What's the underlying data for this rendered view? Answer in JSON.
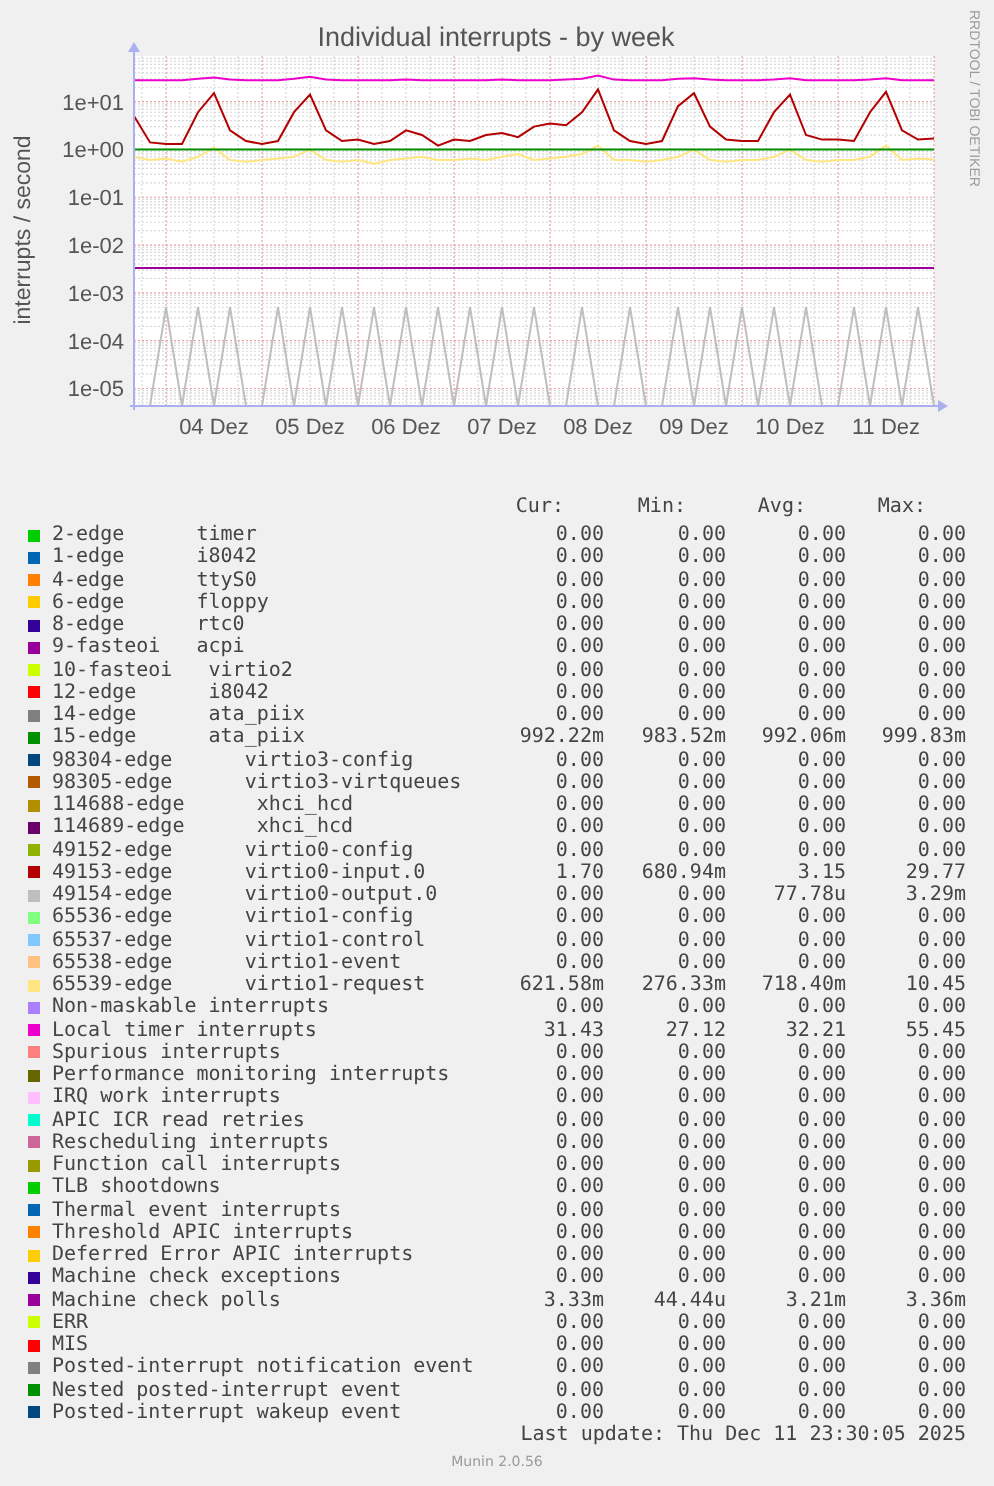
{
  "chart": {
    "title": "Individual interrupts - by week",
    "ylabel": "interrupts / second",
    "credit": "RRDTOOL / TOBI OETIKER",
    "y_labels": [
      "1e+01",
      "1e+00",
      "1e-01",
      "1e-02",
      "1e-03",
      "1e-04",
      "1e-05"
    ],
    "x_labels": [
      "04 Dez",
      "05 Dez",
      "06 Dez",
      "07 Dez",
      "08 Dez",
      "09 Dez",
      "10 Dez",
      "11 Dez"
    ]
  },
  "legend": {
    "columns": [
      "Cur:",
      "Min:",
      "Avg:",
      "Max:"
    ],
    "items": [
      {
        "label": "2-edge      timer",
        "color": "#00cc00",
        "cur": "0.00",
        "min": "0.00",
        "avg": "0.00",
        "max": "0.00"
      },
      {
        "label": "1-edge      i8042",
        "color": "#0066b3",
        "cur": "0.00",
        "min": "0.00",
        "avg": "0.00",
        "max": "0.00"
      },
      {
        "label": "4-edge      ttyS0",
        "color": "#ff8000",
        "cur": "0.00",
        "min": "0.00",
        "avg": "0.00",
        "max": "0.00"
      },
      {
        "label": "6-edge      floppy",
        "color": "#ffcc00",
        "cur": "0.00",
        "min": "0.00",
        "avg": "0.00",
        "max": "0.00"
      },
      {
        "label": "8-edge      rtc0",
        "color": "#330099",
        "cur": "0.00",
        "min": "0.00",
        "avg": "0.00",
        "max": "0.00"
      },
      {
        "label": "9-fasteoi   acpi",
        "color": "#990099",
        "cur": "0.00",
        "min": "0.00",
        "avg": "0.00",
        "max": "0.00"
      },
      {
        "label": "10-fasteoi   virtio2",
        "color": "#ccff00",
        "cur": "0.00",
        "min": "0.00",
        "avg": "0.00",
        "max": "0.00"
      },
      {
        "label": "12-edge      i8042",
        "color": "#ff0000",
        "cur": "0.00",
        "min": "0.00",
        "avg": "0.00",
        "max": "0.00"
      },
      {
        "label": "14-edge      ata_piix",
        "color": "#808080",
        "cur": "0.00",
        "min": "0.00",
        "avg": "0.00",
        "max": "0.00"
      },
      {
        "label": "15-edge      ata_piix",
        "color": "#008f00",
        "cur": "992.22m",
        "min": "983.52m",
        "avg": "992.06m",
        "max": "999.83m"
      },
      {
        "label": "98304-edge      virtio3-config",
        "color": "#00487d",
        "cur": "0.00",
        "min": "0.00",
        "avg": "0.00",
        "max": "0.00"
      },
      {
        "label": "98305-edge      virtio3-virtqueues",
        "color": "#b35a00",
        "cur": "0.00",
        "min": "0.00",
        "avg": "0.00",
        "max": "0.00"
      },
      {
        "label": "114688-edge      xhci_hcd",
        "color": "#b38f00",
        "cur": "0.00",
        "min": "0.00",
        "avg": "0.00",
        "max": "0.00"
      },
      {
        "label": "114689-edge      xhci_hcd",
        "color": "#6b006b",
        "cur": "0.00",
        "min": "0.00",
        "avg": "0.00",
        "max": "0.00"
      },
      {
        "label": "49152-edge      virtio0-config",
        "color": "#8fb300",
        "cur": "0.00",
        "min": "0.00",
        "avg": "0.00",
        "max": "0.00"
      },
      {
        "label": "49153-edge      virtio0-input.0",
        "color": "#b30000",
        "cur": "1.70",
        "min": "680.94m",
        "avg": "3.15",
        "max": "29.77"
      },
      {
        "label": "49154-edge      virtio0-output.0",
        "color": "#bebebe",
        "cur": "0.00",
        "min": "0.00",
        "avg": "77.78u",
        "max": "3.29m"
      },
      {
        "label": "65536-edge      virtio1-config",
        "color": "#80ff80",
        "cur": "0.00",
        "min": "0.00",
        "avg": "0.00",
        "max": "0.00"
      },
      {
        "label": "65537-edge      virtio1-control",
        "color": "#80c9ff",
        "cur": "0.00",
        "min": "0.00",
        "avg": "0.00",
        "max": "0.00"
      },
      {
        "label": "65538-edge      virtio1-event",
        "color": "#ffc080",
        "cur": "0.00",
        "min": "0.00",
        "avg": "0.00",
        "max": "0.00"
      },
      {
        "label": "65539-edge      virtio1-request",
        "color": "#ffe680",
        "cur": "621.58m",
        "min": "276.33m",
        "avg": "718.40m",
        "max": "10.45"
      },
      {
        "label": "Non-maskable interrupts",
        "color": "#aa80ff",
        "cur": "0.00",
        "min": "0.00",
        "avg": "0.00",
        "max": "0.00"
      },
      {
        "label": "Local timer interrupts",
        "color": "#ee00cc",
        "cur": "31.43",
        "min": "27.12",
        "avg": "32.21",
        "max": "55.45"
      },
      {
        "label": "Spurious interrupts",
        "color": "#ff8080",
        "cur": "0.00",
        "min": "0.00",
        "avg": "0.00",
        "max": "0.00"
      },
      {
        "label": "Performance monitoring interrupts",
        "color": "#666600",
        "cur": "0.00",
        "min": "0.00",
        "avg": "0.00",
        "max": "0.00"
      },
      {
        "label": "IRQ work interrupts",
        "color": "#ffbfff",
        "cur": "0.00",
        "min": "0.00",
        "avg": "0.00",
        "max": "0.00"
      },
      {
        "label": "APIC ICR read retries",
        "color": "#00ffcc",
        "cur": "0.00",
        "min": "0.00",
        "avg": "0.00",
        "max": "0.00"
      },
      {
        "label": "Rescheduling interrupts",
        "color": "#cc6699",
        "cur": "0.00",
        "min": "0.00",
        "avg": "0.00",
        "max": "0.00"
      },
      {
        "label": "Function call interrupts",
        "color": "#999900",
        "cur": "0.00",
        "min": "0.00",
        "avg": "0.00",
        "max": "0.00"
      },
      {
        "label": "TLB shootdowns",
        "color": "#00cc00",
        "cur": "0.00",
        "min": "0.00",
        "avg": "0.00",
        "max": "0.00"
      },
      {
        "label": "Thermal event interrupts",
        "color": "#0066b3",
        "cur": "0.00",
        "min": "0.00",
        "avg": "0.00",
        "max": "0.00"
      },
      {
        "label": "Threshold APIC interrupts",
        "color": "#ff8000",
        "cur": "0.00",
        "min": "0.00",
        "avg": "0.00",
        "max": "0.00"
      },
      {
        "label": "Deferred Error APIC interrupts",
        "color": "#ffcc00",
        "cur": "0.00",
        "min": "0.00",
        "avg": "0.00",
        "max": "0.00"
      },
      {
        "label": "Machine check exceptions",
        "color": "#330099",
        "cur": "0.00",
        "min": "0.00",
        "avg": "0.00",
        "max": "0.00"
      },
      {
        "label": "Machine check polls",
        "color": "#990099",
        "cur": "3.33m",
        "min": "44.44u",
        "avg": "3.21m",
        "max": "3.36m"
      },
      {
        "label": "ERR",
        "color": "#ccff00",
        "cur": "0.00",
        "min": "0.00",
        "avg": "0.00",
        "max": "0.00"
      },
      {
        "label": "MIS",
        "color": "#ff0000",
        "cur": "0.00",
        "min": "0.00",
        "avg": "0.00",
        "max": "0.00"
      },
      {
        "label": "Posted-interrupt notification event",
        "color": "#808080",
        "cur": "0.00",
        "min": "0.00",
        "avg": "0.00",
        "max": "0.00"
      },
      {
        "label": "Nested posted-interrupt event",
        "color": "#008f00",
        "cur": "0.00",
        "min": "0.00",
        "avg": "0.00",
        "max": "0.00"
      },
      {
        "label": "Posted-interrupt wakeup event",
        "color": "#00487d",
        "cur": "0.00",
        "min": "0.00",
        "avg": "0.00",
        "max": "0.00"
      }
    ]
  },
  "last_update": "Last update: Thu Dec 11 23:30:05 2025",
  "version": "Munin 2.0.56"
}
